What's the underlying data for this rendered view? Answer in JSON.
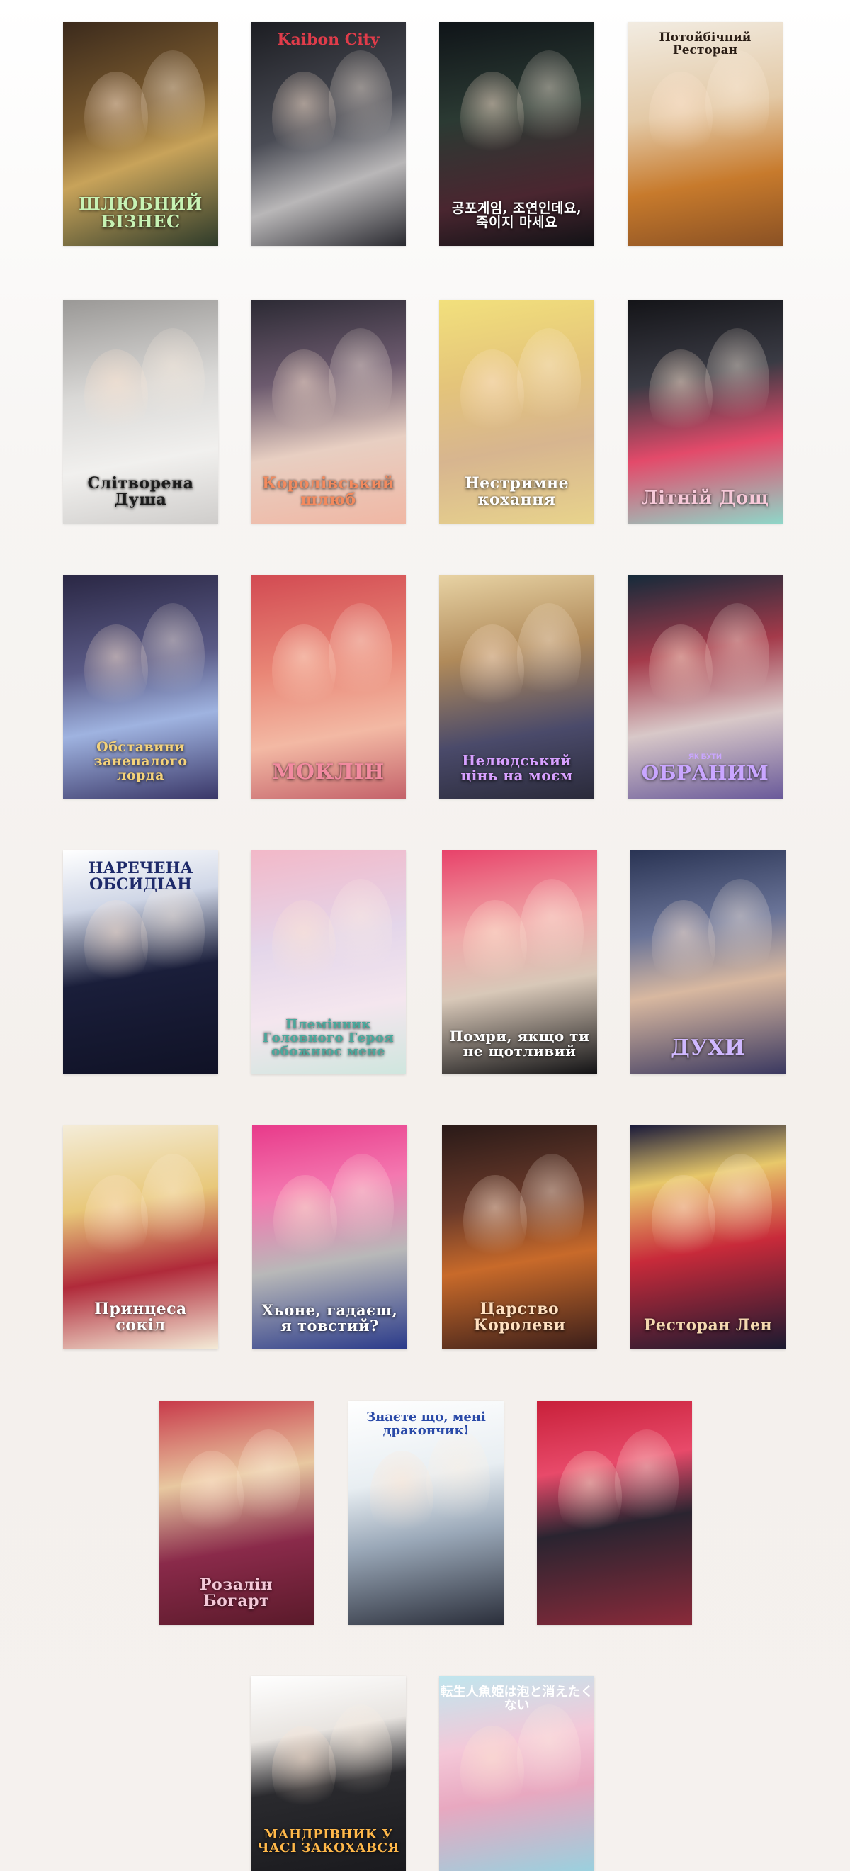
{
  "covers": [
    {
      "title": "ШЛЮБНИЙ БІЗНЕС",
      "bg": "linear-gradient(160deg,#3b2a1c 0%,#7a5a2e 40%,#c8a35a 60%,#2e3b2a 100%)",
      "color": "#c7f2b4",
      "size": 24
    },
    {
      "title": "Kaibon City",
      "bg": "linear-gradient(160deg,#1c1d22 0%,#4a4c55 45%,#b9b7b8 70%,#2a2a30 100%)",
      "color": "#e03c4a",
      "size": 22,
      "top": true
    },
    {
      "title": "공포게임, 조연인데요, 죽이지 마세요",
      "bg": "linear-gradient(170deg,#0f1418 0%,#2b3a33 40%,#4a2630 75%,#121216 100%)",
      "color": "#ffffff",
      "size": 19
    },
    {
      "title": "Потойбічний Ресторан",
      "bg": "linear-gradient(170deg,#f2ece2 0%,#e3c9a6 40%,#c77a2c 70%,#8a5124 100%)",
      "color": "#2a1d15",
      "size": 17,
      "top": true
    },
    {
      "title": "Слітворена Душа",
      "bg": "linear-gradient(170deg,#9a9896 0%,#d9d8d6 40%,#f1f0ee 70%,#cfcdcb 100%)",
      "color": "#1b1b1b",
      "size": 22
    },
    {
      "title": "Королівський шлюб",
      "bg": "linear-gradient(170deg,#2c2a34 0%,#6c5a6e 35%,#e8cfc2 65%,#f0b7a4 100%)",
      "color": "#f38a5e",
      "size": 22
    },
    {
      "title": "Нестримне кохання",
      "bg": "linear-gradient(170deg,#f2e07c 0%,#e4c47a 35%,#d7b58f 65%,#e8d38c 100%)",
      "color": "#ffffff",
      "size": 22
    },
    {
      "title": "Літній Дощ",
      "bg": "linear-gradient(170deg,#141418 0%,#3a3b44 35%,#e34a6a 65%,#8fd6c8 100%)",
      "color": "#f7c9d9",
      "size": 26
    },
    {
      "title": "Обставини занепалого лорда",
      "bg": "linear-gradient(170deg,#2a2744 0%,#5a5a86 40%,#9fb3e0 65%,#3a3768 100%)",
      "color": "#f4d27a",
      "size": 19
    },
    {
      "title": "МОКЛІН",
      "bg": "linear-gradient(170deg,#d24a52 0%,#e98676 40%,#f3b9a4 70%,#c4626a 100%)",
      "color": "#f28aa0",
      "size": 30
    },
    {
      "title": "Нелюдський цінь на моєм",
      "bg": "linear-gradient(170deg,#e8d3a4 0%,#b08a5a 35%,#4a4a6a 70%,#2a2a3a 100%)",
      "color": "#d7a0ff",
      "size": 20
    },
    {
      "title": "ОБРАНИМ",
      "sub": "ЯК БУТИ",
      "bg": "linear-gradient(170deg,#142a3a 0%,#a43a4a 35%,#d8c8c8 65%,#6a5a9a 100%)",
      "color": "#c9a6ff",
      "size": 28
    },
    {
      "title": "НАРЕЧЕНА ОБСИДІАН",
      "bg": "linear-gradient(170deg,#ffffff 0%,#cfd6e6 25%,#1a1e3a 55%,#101226 100%)",
      "color": "#1e2a6a",
      "size": 22,
      "top": true
    },
    {
      "title": "Племінник Головного Героя обожнює мене",
      "bg": "linear-gradient(170deg,#f2b8c8 0%,#e4d6ea 40%,#f4e6ee 70%,#cfe6de 100%)",
      "color": "#4aa89c",
      "size": 18
    },
    {
      "title": "Помри, якщо ти не щотливий",
      "bg": "linear-gradient(170deg,#e8426a 0%,#f0a8a8 35%,#d8c8b8 60%,#121214 100%)",
      "color": "#ffffff",
      "size": 20
    },
    {
      "title": "ДУХИ",
      "bg": "linear-gradient(170deg,#2a3454 0%,#6a7498 35%,#d8b8a0 60%,#3a3860 100%)",
      "color": "#d0b8ff",
      "size": 30
    },
    {
      "title": "Принцеса сокіл",
      "bg": "linear-gradient(170deg,#f4ecd8 0%,#e8c87a 35%,#b02a3a 65%,#f4ecd8 100%)",
      "color": "#ffffff",
      "size": 22
    },
    {
      "title": "Хьоне, гадаєш, я товстий?",
      "bg": "linear-gradient(170deg,#e83a8a 0%,#f478b0 30%,#b8b8b8 60%,#2a3a8a 100%)",
      "color": "#ffffff",
      "size": 21
    },
    {
      "title": "Царство Королеви",
      "bg": "linear-gradient(170deg,#2a1a18 0%,#6a3a2a 35%,#c86a2a 60%,#3a1e1a 100%)",
      "color": "#ffe0c0",
      "size": 22
    },
    {
      "title": "Ресторан Лен",
      "bg": "linear-gradient(170deg,#1a1a3a 0%,#e8c86a 25%,#c82a3a 55%,#1a1a30 100%)",
      "color": "#f4d8b0",
      "size": 22
    },
    {
      "title": "Розалін Богарт",
      "bg": "linear-gradient(170deg,#c83a4a 0%,#e8c8a0 35%,#8a2a4a 65%,#5a1a2a 100%)",
      "color": "#f4c8d8",
      "size": 22
    },
    {
      "title": "Знаєте що, мені дракончик!",
      "bg": "linear-gradient(170deg,#ffffff 0%,#e8eef2 35%,#9aa8b8 60%,#2a2e3a 100%)",
      "color": "#2a4aa8",
      "size": 18,
      "top": true
    },
    {
      "title": "",
      "bg": "linear-gradient(170deg,#c8203a 0%,#e84a6a 30%,#2a2430 55%,#8a2a3a 100%)",
      "color": "#ffffff",
      "size": 20
    },
    {
      "title": "МАНДРІВНИК У ЧАСІ ЗАКОХАВСЯ",
      "bg": "linear-gradient(170deg,#ffffff 0%,#e8e4e0 30%,#2a2a2e 55%,#1a1a1e 100%)",
      "color": "#ffb84a",
      "size": 18
    },
    {
      "title": "転生人魚姫は泡と消えたくない",
      "bg": "linear-gradient(170deg,#bfe6ee 0%,#f4c8d8 35%,#e8a8c0 60%,#9ad0de 100%)",
      "color": "#ffffff",
      "size": 18,
      "top": true
    }
  ]
}
